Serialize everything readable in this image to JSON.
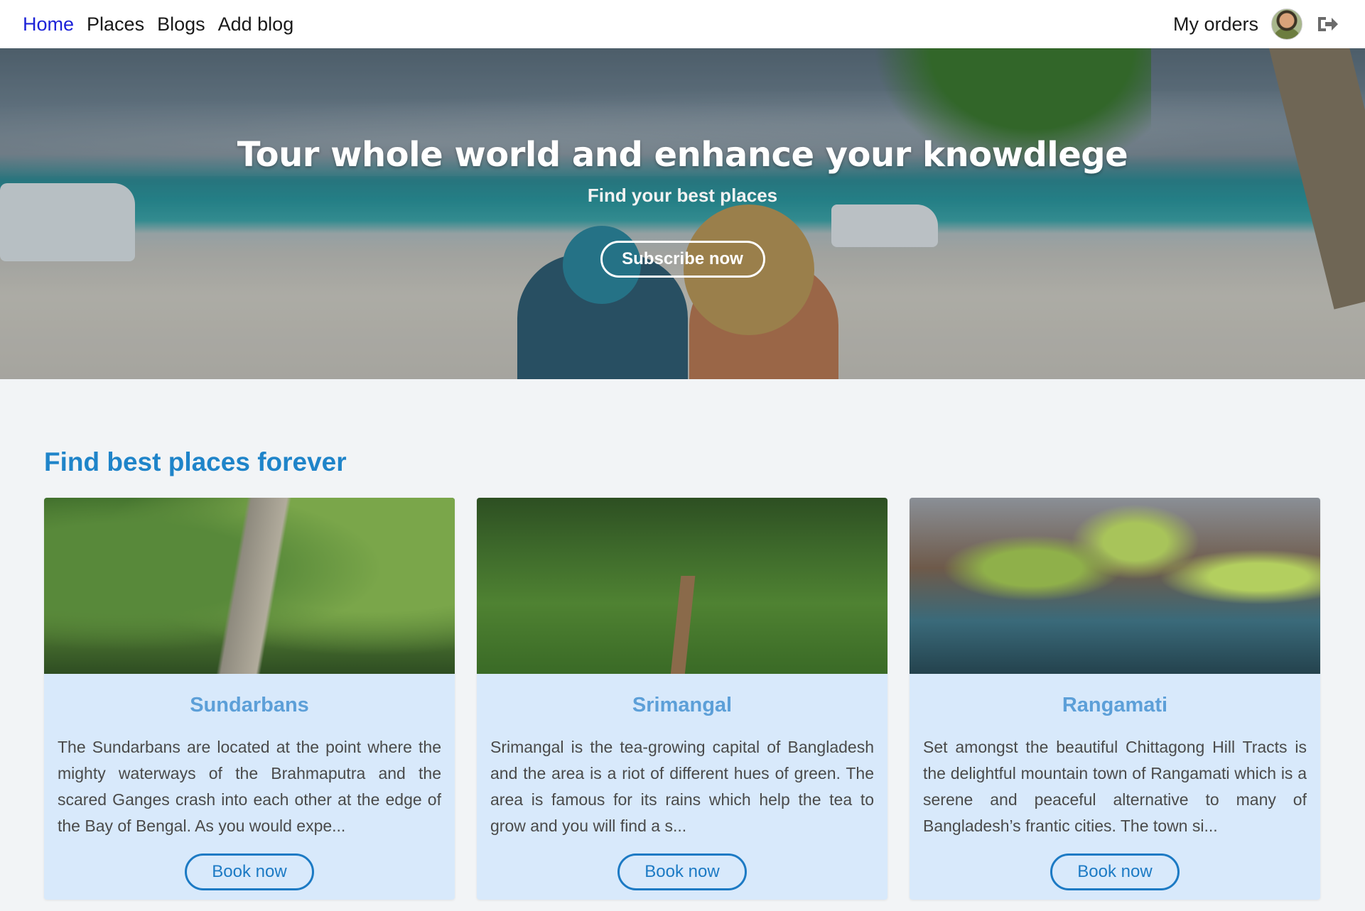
{
  "nav": {
    "links": [
      {
        "label": "Home",
        "active": true
      },
      {
        "label": "Places",
        "active": false
      },
      {
        "label": "Blogs",
        "active": false
      },
      {
        "label": "Add blog",
        "active": false
      }
    ],
    "my_orders": "My orders",
    "avatar_icon": "user-avatar",
    "logout_icon": "sign-out-icon"
  },
  "hero": {
    "title": "Tour whole world and enhance your knowdlege",
    "subtitle": "Find your best places",
    "button": "Subscribe now"
  },
  "section": {
    "title": "Find best places forever"
  },
  "places": [
    {
      "title": "Sundarbans",
      "description": "The Sundarbans are located at the point where the mighty waterways of the Brahmaputra and the scared Ganges crash into each other at the edge of the Bay of Bengal. As you would expe...",
      "button": "Book now"
    },
    {
      "title": "Srimangal",
      "description": "Srimangal is the tea-growing capital of Bangladesh and the area is a riot of different hues of green. The area is famous for its rains which help the tea to grow and you will find a s...",
      "button": "Book now"
    },
    {
      "title": "Rangamati",
      "description": "Set amongst the beautiful Chittagong Hill Tracts is the delightful mountain town of Rangamati which is a serene and peaceful alternative to many of Bangladesh’s frantic cities. The town si...",
      "button": "Book now"
    }
  ],
  "colors": {
    "nav_active": "#1c22d8",
    "section_title": "#1f84c9",
    "card_bg": "#d8e9fb",
    "card_title": "#5c9fd8",
    "book_button": "#1c7ac4",
    "page_bg": "#f2f4f6"
  }
}
